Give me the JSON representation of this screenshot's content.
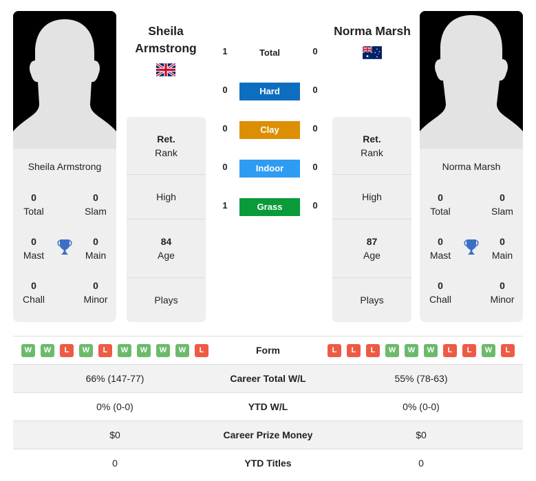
{
  "players": [
    {
      "name": "Sheila Armstrong",
      "name_lines": [
        "Sheila",
        "Armstrong"
      ],
      "flag": "united-kingdom-flag",
      "card": {
        "name": "Sheila Armstrong",
        "titles": {
          "total": {
            "value": "0",
            "label": "Total"
          },
          "slam": {
            "value": "0",
            "label": "Slam"
          },
          "mast": {
            "value": "0",
            "label": "Mast"
          },
          "main": {
            "value": "0",
            "label": "Main"
          },
          "chall": {
            "value": "0",
            "label": "Chall"
          },
          "minor": {
            "value": "0",
            "label": "Minor"
          }
        }
      },
      "info": {
        "rank": {
          "value": "Ret.",
          "label": "Rank"
        },
        "high": {
          "label": "High"
        },
        "age": {
          "value": "84",
          "label": "Age"
        },
        "plays": {
          "label": "Plays"
        }
      },
      "form": [
        "W",
        "W",
        "L",
        "W",
        "L",
        "W",
        "W",
        "W",
        "W",
        "L"
      ],
      "career_total_wl": "66% (147-77)",
      "ytd_wl": "0% (0-0)",
      "career_prize_money": "$0",
      "ytd_titles": "0"
    },
    {
      "name": "Norma Marsh",
      "name_lines": [
        "Norma Marsh"
      ],
      "flag": "australia-flag",
      "card": {
        "name": "Norma Marsh",
        "titles": {
          "total": {
            "value": "0",
            "label": "Total"
          },
          "slam": {
            "value": "0",
            "label": "Slam"
          },
          "mast": {
            "value": "0",
            "label": "Mast"
          },
          "main": {
            "value": "0",
            "label": "Main"
          },
          "chall": {
            "value": "0",
            "label": "Chall"
          },
          "minor": {
            "value": "0",
            "label": "Minor"
          }
        }
      },
      "info": {
        "rank": {
          "value": "Ret.",
          "label": "Rank"
        },
        "high": {
          "label": "High"
        },
        "age": {
          "value": "87",
          "label": "Age"
        },
        "plays": {
          "label": "Plays"
        }
      },
      "form": [
        "L",
        "L",
        "L",
        "W",
        "W",
        "W",
        "L",
        "L",
        "W",
        "L"
      ],
      "career_total_wl": "55% (78-63)",
      "ytd_wl": "0% (0-0)",
      "career_prize_money": "$0",
      "ytd_titles": "0"
    }
  ],
  "h2h": {
    "total": {
      "label": "Total",
      "left": "1",
      "right": "0"
    },
    "surfaces": [
      {
        "label": "Hard",
        "left": "0",
        "right": "0",
        "color": "#0d6ebf"
      },
      {
        "label": "Clay",
        "left": "0",
        "right": "0",
        "color": "#dd8f04"
      },
      {
        "label": "Indoor",
        "left": "0",
        "right": "0",
        "color": "#2f9cf4"
      },
      {
        "label": "Grass",
        "left": "1",
        "right": "0",
        "color": "#0a9a3a"
      }
    ]
  },
  "table": {
    "form_label": "Form",
    "career_total_label": "Career Total W/L",
    "ytd_wl_label": "YTD W/L",
    "prize_label": "Career Prize Money",
    "ytd_titles_label": "YTD Titles"
  },
  "colors": {
    "win": "#6cba6c",
    "loss": "#ee5b44",
    "trophy": "#3a6fc4"
  }
}
